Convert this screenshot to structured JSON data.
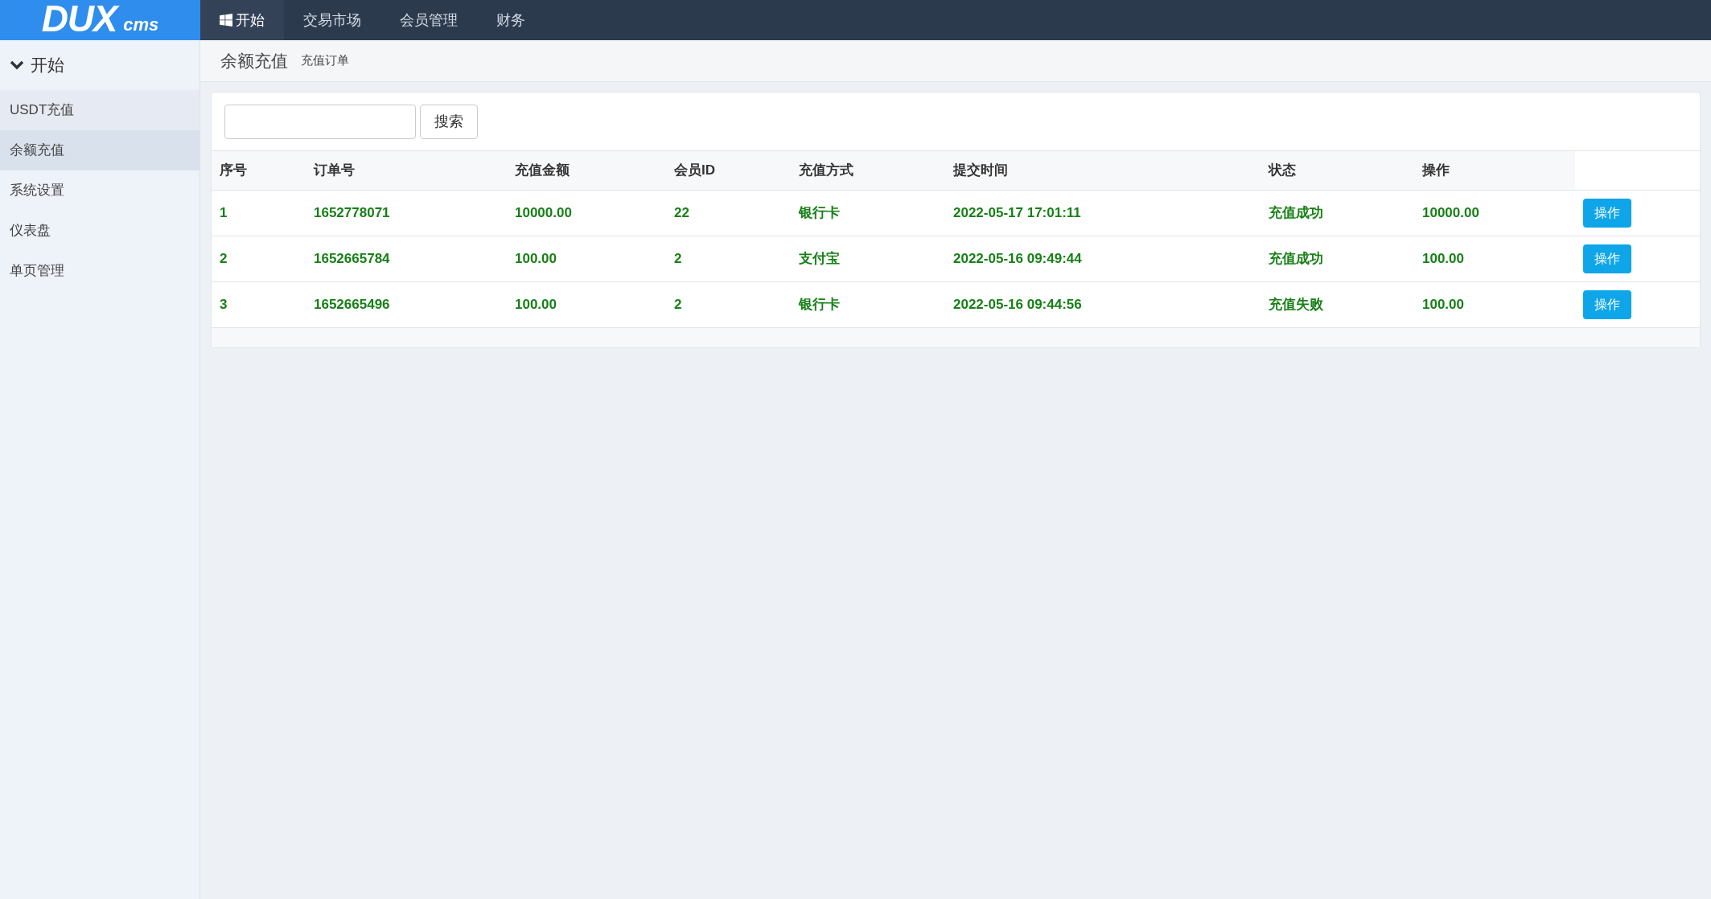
{
  "logo": {
    "main": "DUX",
    "sub": "cms"
  },
  "nav": [
    {
      "label": "开始",
      "selected": true
    },
    {
      "label": "交易市场",
      "selected": false
    },
    {
      "label": "会员管理",
      "selected": false
    },
    {
      "label": "财务",
      "selected": false
    }
  ],
  "sidebar": {
    "section": {
      "label": "开始",
      "expanded": true
    },
    "items": [
      {
        "label": "USDT充值",
        "selected": false
      },
      {
        "label": "余额充值",
        "selected": true
      },
      {
        "label": "系统设置",
        "selected": false
      },
      {
        "label": "仪表盘",
        "selected": false
      },
      {
        "label": "单页管理",
        "selected": false
      }
    ]
  },
  "page": {
    "title": "余额充值",
    "subtitle": "充值订单"
  },
  "search": {
    "button": "搜索"
  },
  "table": {
    "columns": [
      "序号",
      "订单号",
      "充值金额",
      "会员ID",
      "充值方式",
      "提交时间",
      "状态",
      "操作"
    ],
    "rows": [
      {
        "cells": [
          "1",
          "1652778071",
          "10000.00",
          "22",
          "银行卡",
          "2022-05-17 17:01:11",
          "充值成功",
          "10000.00"
        ],
        "action": "操作"
      },
      {
        "cells": [
          "2",
          "1652665784",
          "100.00",
          "2",
          "支付宝",
          "2022-05-16 09:49:44",
          "充值成功",
          "100.00"
        ],
        "action": "操作"
      },
      {
        "cells": [
          "3",
          "1652665496",
          "100.00",
          "2",
          "银行卡",
          "2022-05-16 09:44:56",
          "充值失败",
          "100.00"
        ],
        "action": "操作"
      }
    ]
  }
}
